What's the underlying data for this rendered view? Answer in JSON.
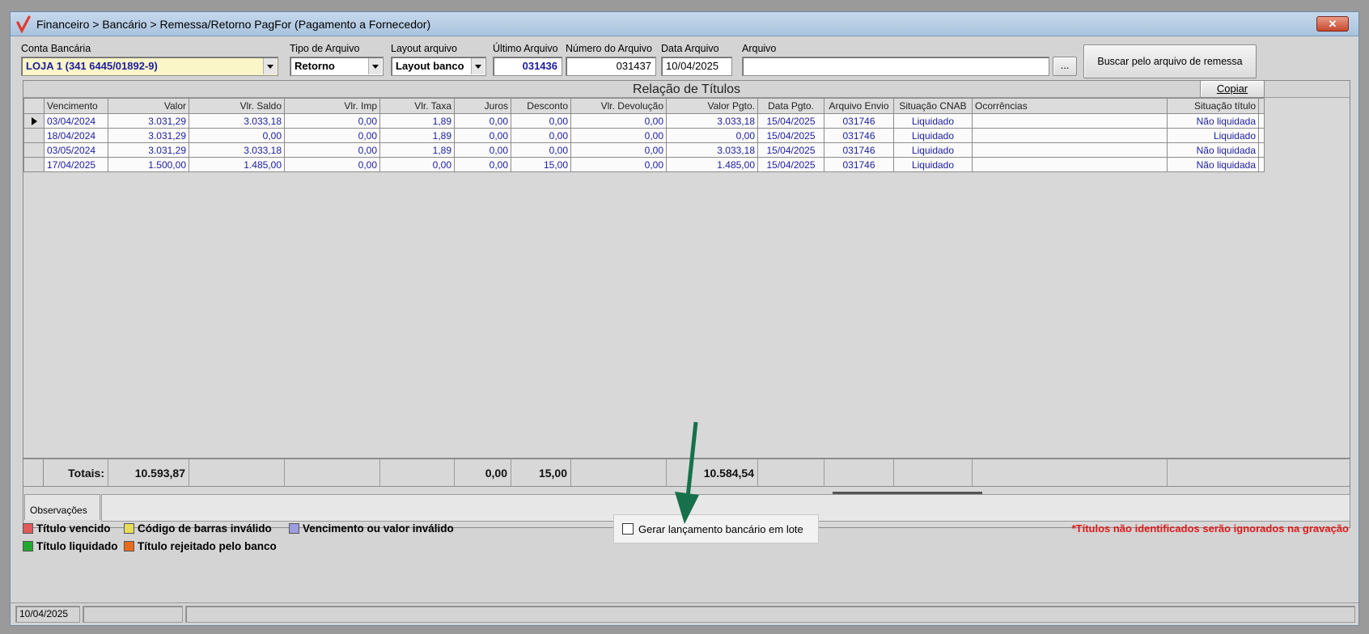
{
  "window": {
    "title": "Financeiro > Bancário > Remessa/Retorno PagFor (Pagamento  a Fornecedor)",
    "close_label": "✕"
  },
  "filters": {
    "conta_label": "Conta Bancária",
    "conta_value": "LOJA 1 (341 6445/01892-9)",
    "tipo_label": "Tipo de Arquivo",
    "tipo_value": "Retorno",
    "layout_label": "Layout arquivo",
    "layout_value": "Layout banco",
    "ultimo_label": "Último Arquivo",
    "ultimo_value": "031436",
    "numero_label": "Número do Arquivo",
    "numero_value": "031437",
    "data_label": "Data Arquivo",
    "data_value": "10/04/2025",
    "arquivo_label": "Arquivo",
    "arquivo_value": "",
    "browse_label": "...",
    "buscar_label": "Buscar pelo arquivo de remessa"
  },
  "grid": {
    "caption": "Relação de Títulos",
    "copy_label": "Copiar",
    "columns": [
      "Vencimento",
      "Valor",
      "Vlr. Saldo",
      "Vlr. Imp",
      "Vlr. Taxa",
      "Juros",
      "Desconto",
      "Vlr. Devolução",
      "Valor Pgto.",
      "Data Pgto.",
      "Arquivo Envio",
      "Situação CNAB",
      "Ocorrências",
      "Situação título"
    ],
    "rows": [
      [
        "03/04/2024",
        "3.031,29",
        "3.033,18",
        "0,00",
        "1,89",
        "0,00",
        "0,00",
        "0,00",
        "3.033,18",
        "15/04/2025",
        "031746",
        "Liquidado",
        "",
        "Não liquidada"
      ],
      [
        "18/04/2024",
        "3.031,29",
        "0,00",
        "0,00",
        "1,89",
        "0,00",
        "0,00",
        "0,00",
        "0,00",
        "15/04/2025",
        "031746",
        "Liquidado",
        "",
        "Liquidado"
      ],
      [
        "03/05/2024",
        "3.031,29",
        "3.033,18",
        "0,00",
        "1,89",
        "0,00",
        "0,00",
        "0,00",
        "3.033,18",
        "15/04/2025",
        "031746",
        "Liquidado",
        "",
        "Não liquidada"
      ],
      [
        "17/04/2025",
        "1.500,00",
        "1.485,00",
        "0,00",
        "0,00",
        "0,00",
        "15,00",
        "0,00",
        "1.485,00",
        "15/04/2025",
        "031746",
        "Liquidado",
        "",
        "Não liquidada"
      ]
    ],
    "totals": {
      "label": "Totais:",
      "valor": "10.593,87",
      "juros": "0,00",
      "desconto": "15,00",
      "valor_pgto": "10.584,54"
    }
  },
  "observacoes_label": "Observações",
  "legend": [
    {
      "label": "Título vencido",
      "color": "#e05a5a"
    },
    {
      "label": "Código de barras inválido",
      "color": "#e6dc5a"
    },
    {
      "label": "Vencimento ou valor inválido",
      "color": "#9d9de0"
    },
    {
      "label": "Título liquidado",
      "color": "#21a82e"
    },
    {
      "label": "Título rejeitado pelo banco",
      "color": "#e86a1c"
    }
  ],
  "lote_checkbox_label": "Gerar lançamento bancário em lote",
  "warning": "*Títulos não identificados serão ignorados na gravação",
  "status": {
    "date": "10/04/2025"
  },
  "colors": {
    "arrow": "#16714b",
    "link_blue": "#1d1d9e",
    "warning_red": "#e01b1b"
  }
}
